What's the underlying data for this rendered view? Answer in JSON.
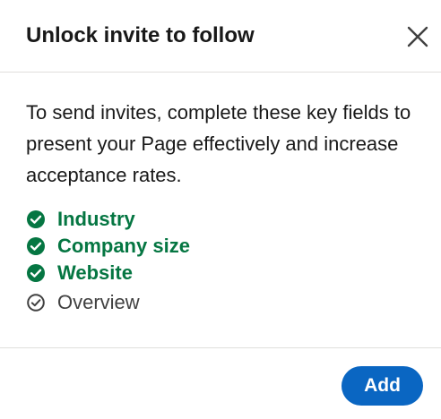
{
  "modal": {
    "title": "Unlock invite to follow",
    "close_icon": "close-icon",
    "description": "To send invites, complete these key fields to present your Page effectively and increase acceptance rates.",
    "checklist": [
      {
        "label": "Industry",
        "status": "complete",
        "icon": "check-circle-filled-icon"
      },
      {
        "label": "Company size",
        "status": "complete",
        "icon": "check-circle-filled-icon"
      },
      {
        "label": "Website",
        "status": "complete",
        "icon": "check-circle-filled-icon"
      },
      {
        "label": "Overview",
        "status": "incomplete",
        "icon": "check-circle-outline-icon"
      }
    ],
    "add_button_label": "Add"
  },
  "colors": {
    "complete": "#057642",
    "incomplete": "#404040",
    "primary_button": "#0a66c2"
  }
}
